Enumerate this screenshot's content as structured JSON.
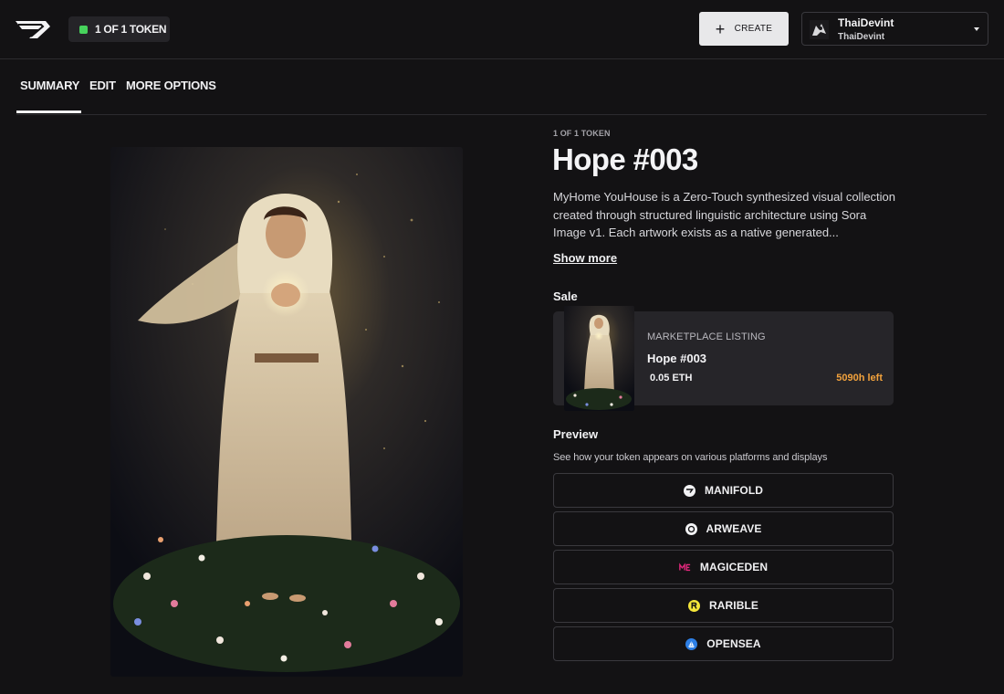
{
  "header": {
    "token_badge": "1 OF 1 TOKEN",
    "create_label": "CREATE",
    "account": {
      "name": "ThaiDevint",
      "handle": "ThaiDevint"
    }
  },
  "tabs": [
    {
      "label": "SUMMARY",
      "active": true
    },
    {
      "label": "EDIT",
      "active": false
    },
    {
      "label": "MORE OPTIONS",
      "active": false
    }
  ],
  "token": {
    "eyebrow": "1 OF 1 TOKEN",
    "title": "Hope #003",
    "description": "MyHome YouHouse is a Zero-Touch synthesized visual collection created through structured linguistic architecture using Sora Image v1. Each artwork exists as a native generated...",
    "show_more": "Show more"
  },
  "sale": {
    "heading": "Sale",
    "listing_label": "MARKETPLACE LISTING",
    "name": "Hope #003",
    "price": "0.05 ETH",
    "time_left": "5090h left"
  },
  "preview": {
    "heading": "Preview",
    "subtitle": "See how your token appears on various platforms and displays",
    "platforms": [
      {
        "label": "MANIFOLD",
        "icon": "manifold-icon"
      },
      {
        "label": "ARWEAVE",
        "icon": "arweave-icon"
      },
      {
        "label": "MAGICEDEN",
        "icon": "magiceden-icon"
      },
      {
        "label": "RARIBLE",
        "icon": "rarible-icon"
      },
      {
        "label": "OPENSEA",
        "icon": "opensea-icon"
      }
    ]
  },
  "colors": {
    "background": "#131214",
    "card": "#262529",
    "accent_time": "#f2a23c",
    "badge_dot": "#47d35c"
  }
}
